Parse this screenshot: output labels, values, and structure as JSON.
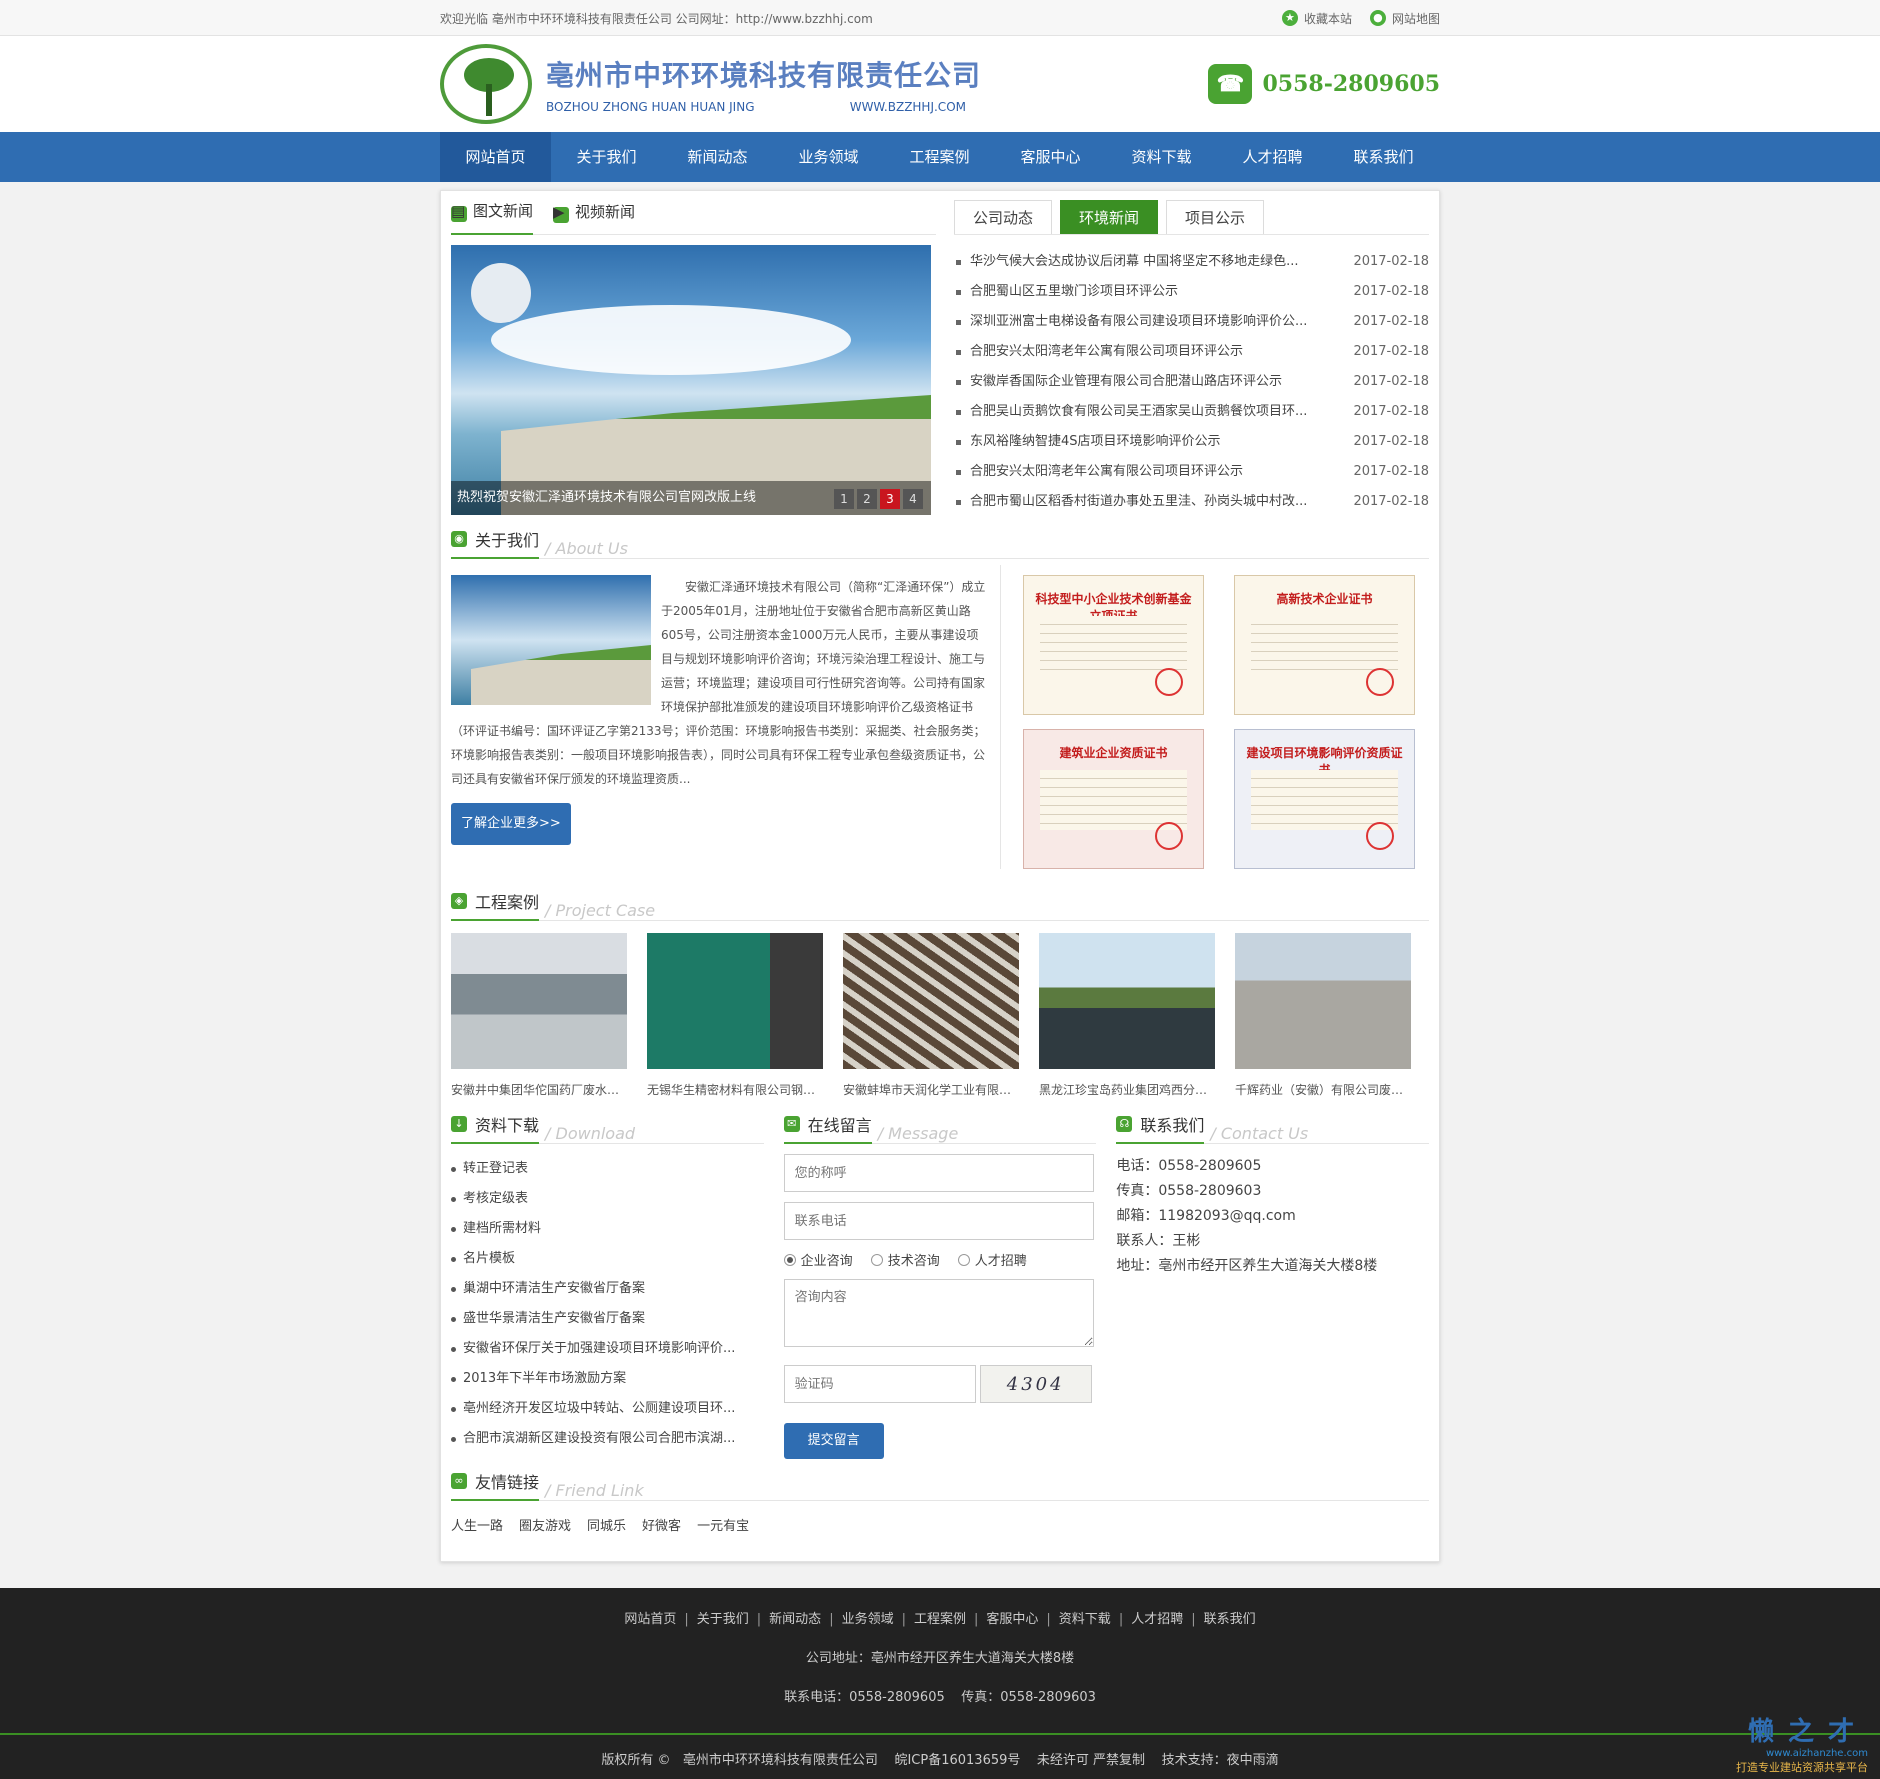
{
  "topbar": {
    "welcome": "欢迎光临 亳州市中环环境科技有限责任公司 公司网址：http://www.bzzhhj.com",
    "favorite": "收藏本站",
    "sitemap": "网站地图"
  },
  "header": {
    "company_cn": "亳州市中环环境科技有限责任公司",
    "company_pinyin": "BOZHOU ZHONG HUAN HUAN JING",
    "website": "WWW.BZZHHJ.COM",
    "phone": "0558-2809605"
  },
  "nav": [
    "网站首页",
    "关于我们",
    "新闻动态",
    "业务领域",
    "工程案例",
    "客服中心",
    "资料下载",
    "人才招聘",
    "联系我们"
  ],
  "news_left": {
    "tabs": [
      "图文新闻",
      "视频新闻"
    ],
    "caption": "热烈祝贺安徽汇泽通环境技术有限公司官网改版上线",
    "pages": [
      "1",
      "2",
      "3",
      "4"
    ],
    "current_page": 3
  },
  "news_right": {
    "tabs": [
      "公司动态",
      "环境新闻",
      "项目公示"
    ],
    "active_tab": "环境新闻",
    "items": [
      {
        "title": "华沙气候大会达成协议后闭幕 中国将坚定不移地走绿色...",
        "date": "2017-02-18"
      },
      {
        "title": "合肥蜀山区五里墩门诊项目环评公示",
        "date": "2017-02-18"
      },
      {
        "title": "深圳亚洲富士电梯设备有限公司建设项目环境影响评价公...",
        "date": "2017-02-18"
      },
      {
        "title": "合肥安兴太阳湾老年公寓有限公司项目环评公示",
        "date": "2017-02-18"
      },
      {
        "title": "安徽岸香国际企业管理有限公司合肥潜山路店环评公示",
        "date": "2017-02-18"
      },
      {
        "title": "合肥吴山贡鹅饮食有限公司吴王酒家吴山贡鹅餐饮项目环...",
        "date": "2017-02-18"
      },
      {
        "title": "东风裕隆纳智捷4S店项目环境影响评价公示",
        "date": "2017-02-18"
      },
      {
        "title": "合肥安兴太阳湾老年公寓有限公司项目环评公示",
        "date": "2017-02-18"
      },
      {
        "title": "合肥市蜀山区稻香村街道办事处五里洼、孙岗头城中村改...",
        "date": "2017-02-18"
      }
    ]
  },
  "about": {
    "title": "关于我们",
    "en": "/ About Us",
    "body": "安徽汇泽通环境技术有限公司（简称“汇泽通环保”）成立于2005年01月，注册地址位于安徽省合肥市高新区黄山路605号，公司注册资本金1000万元人民币，主要从事建设项目与规划环境影响评价咨询；环境污染治理工程设计、施工与运营；环境监理；建设项目可行性研究咨询等。公司持有国家环境保护部批准颁发的建设项目环境影响评价乙级资格证书（环评证书编号：国环评证乙字第2133号；评价范围：环境影响报告书类别：采掘类、社会服务类；环境影响报告表类别：一般项目环境影响报告表），同时公司具有环保工程专业承包叁级资质证书，公司还具有安徽省环保厅颁发的环境监理资质...",
    "more": "了解企业更多>>",
    "certs": [
      "科技型中小企业技术创新基金 立项证书",
      "高新技术企业证书",
      "建筑业企业资质证书",
      "建设项目环境影响评价资质证书"
    ]
  },
  "cases": {
    "title": "工程案例",
    "en": "/ Project Case",
    "items": [
      "安徽井中集团华佗国药厂废水处...",
      "无锡华生精密材料有限公司钢带...",
      "安徽蚌埠市天润化学工业有限公...",
      "黑龙江珍宝岛药业集团鸡西分公...",
      "千辉药业（安徽）有限公司废水..."
    ]
  },
  "download": {
    "title": "资料下载",
    "en": "/ Download",
    "items": [
      "转正登记表",
      "考核定级表",
      "建档所需材料",
      "名片模板",
      "巢湖中环清洁生产安徽省厅备案",
      "盛世华景清洁生产安徽省厅备案",
      "安徽省环保厅关于加强建设项目环境影响评价...",
      "2013年下半年市场激励方案",
      "亳州经济开发区垃圾中转站、公厕建设项目环...",
      "合肥市滨湖新区建设投资有限公司合肥市滨湖..."
    ]
  },
  "message": {
    "title": "在线留言",
    "en": "/ Message",
    "name_placeholder": "您的称呼",
    "phone_placeholder": "联系电话",
    "radios": [
      "企业咨询",
      "技术咨询",
      "人才招聘"
    ],
    "selected_radio": "企业咨询",
    "content_placeholder": "咨询内容",
    "captcha_placeholder": "验证码",
    "captcha_text": "4304",
    "submit": "提交留言"
  },
  "contact": {
    "title": "联系我们",
    "en": "/ Contact Us",
    "lines": [
      "电话：0558-2809605",
      "传真：0558-2809603",
      "邮箱：11982093@qq.com",
      "联系人：王彬",
      "地址：亳州市经开区养生大道海关大楼8楼"
    ]
  },
  "friends": {
    "title": "友情链接",
    "en": "/ Friend Link",
    "items": [
      "人生一路",
      "圈友游戏",
      "同城乐",
      "好微客",
      "一元有宝"
    ]
  },
  "footer": {
    "nav": [
      "网站首页",
      "关于我们",
      "新闻动态",
      "业务领域",
      "工程案例",
      "客服中心",
      "资料下载",
      "人才招聘",
      "联系我们"
    ],
    "address": "公司地址：亳州市经开区养生大道海关大楼8楼",
    "phones": "联系电话：0558-2809605    传真：0558-2809603",
    "copyright": "版权所有 ©   亳州市中环环境科技有限责任公司    皖ICP备16013659号    未经许可 严禁复制    技术支持：夜中雨滴"
  },
  "watermark": {
    "big": "懒之才",
    "url": "www.aizhanzhe.com",
    "slogan": "打造专业建站资源共享平台"
  }
}
